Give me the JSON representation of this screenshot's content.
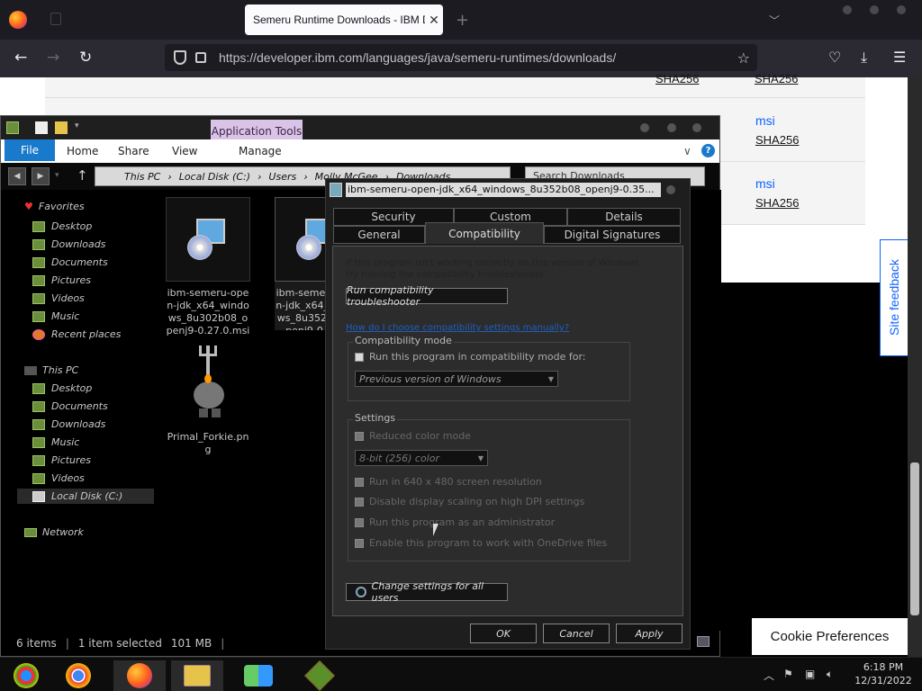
{
  "browser": {
    "tab_title": "Semeru Runtime Downloads - IBM D",
    "tab_close": "✕",
    "new_tab": "+",
    "url": "https://developer.ibm.com/languages/java/semeru-runtimes/downloads/"
  },
  "webpage": {
    "sha_top_1": "SHA256",
    "sha_top_2": "SHA256",
    "row1_type": "msi",
    "row1_sha": "SHA256",
    "row2_type": "msi",
    "row2_sha": "SHA256",
    "site_feedback": "Site feedback",
    "cookie_preferences": "Cookie Preferences"
  },
  "explorer": {
    "app_tools": "Application Tools",
    "ribbon_tabs": [
      "File",
      "Home",
      "Share",
      "View",
      "Manage"
    ],
    "breadcrumb": [
      "This PC",
      "Local Disk (C:)",
      "Users",
      "Molly McGee",
      "Downloads"
    ],
    "search_placeholder": "Search Downloads",
    "favorites_label": "Favorites",
    "favorites": [
      "Desktop",
      "Downloads",
      "Documents",
      "Pictures",
      "Videos",
      "Music",
      "Recent places"
    ],
    "thispc_label": "This PC",
    "thispc": [
      "Desktop",
      "Documents",
      "Downloads",
      "Music",
      "Pictures",
      "Videos",
      "Local Disk (C:)"
    ],
    "network_label": "Network",
    "files": [
      {
        "name": "ibm-semeru-open-jdk_x64_windows_8u302b08_openj9-0.27.0.msi"
      },
      {
        "name": "ibm-semeru-open-jdk_x64_windows_8u352b08_openj9-0.35..."
      },
      {
        "name": "Primal_Forkie.png"
      }
    ],
    "status_items": "6 items",
    "status_selected": "1 item selected",
    "status_size": "101 MB"
  },
  "dialog": {
    "title": "ibm-semeru-open-jdk_x64_windows_8u352b08_openj9-0.35...",
    "tabs_row1": [
      "Security",
      "Custom",
      "Details"
    ],
    "tabs_row2": [
      "General",
      "Compatibility",
      "Digital Signatures"
    ],
    "intro": "If this program isn't working correctly on this version of Windows, try running the compatibility troubleshooter.",
    "troubleshooter_btn": "Run compatibility troubleshooter",
    "manual_link": "How do I choose compatibility settings manually?",
    "compat_mode_label": "Compatibility mode",
    "compat_checkbox": "Run this program in compatibility mode for:",
    "compat_select": "Previous version of Windows",
    "settings_label": "Settings",
    "reduced_color": "Reduced color mode",
    "color_select": "8-bit (256) color",
    "run_640": "Run in 640 x 480 screen resolution",
    "disable_dpi": "Disable display scaling on high DPI settings",
    "run_admin": "Run this program as an administrator",
    "onedrive": "Enable this program to work with OneDrive files",
    "change_all_users": "Change settings for all users",
    "ok": "OK",
    "cancel": "Cancel",
    "apply": "Apply"
  },
  "taskbar": {
    "time": "6:18 PM",
    "date": "12/31/2022"
  }
}
